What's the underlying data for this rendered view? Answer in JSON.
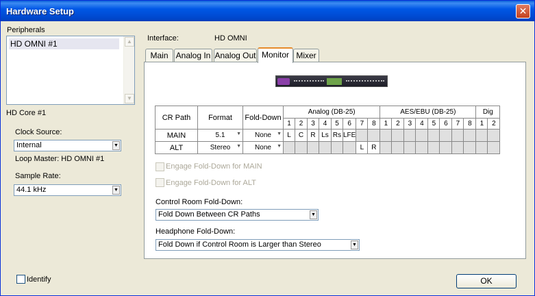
{
  "window": {
    "title": "Hardware Setup",
    "close_glyph": "✕"
  },
  "peripherals": {
    "label": "Peripherals",
    "items": [
      "HD OMNI #1"
    ]
  },
  "core": {
    "label": "HD Core #1",
    "clock_source_label": "Clock Source:",
    "clock_source_value": "Internal",
    "loop_master": "Loop Master: HD OMNI #1",
    "sample_rate_label": "Sample Rate:",
    "sample_rate_value": "44.1 kHz"
  },
  "interface": {
    "label": "Interface:",
    "value": "HD OMNI"
  },
  "tabs": [
    {
      "label": "Main"
    },
    {
      "label": "Analog In"
    },
    {
      "label": "Analog Out"
    },
    {
      "label": "Monitor",
      "active": true
    },
    {
      "label": "Mixer"
    }
  ],
  "grid": {
    "headers": {
      "cr_path": "CR Path",
      "format": "Format",
      "fold_down": "Fold-Down",
      "analog": "Analog (DB-25)",
      "aes": "AES/EBU (DB-25)",
      "dig": "Dig"
    },
    "analog_nums": [
      "1",
      "2",
      "3",
      "4",
      "5",
      "6",
      "7",
      "8"
    ],
    "aes_nums": [
      "1",
      "2",
      "3",
      "4",
      "5",
      "6",
      "7",
      "8"
    ],
    "dig_nums": [
      "1",
      "2"
    ],
    "rows": [
      {
        "path": "MAIN",
        "format": "5.1",
        "fold": "None",
        "analog": [
          "L",
          "C",
          "R",
          "Ls",
          "Rs",
          "LFE",
          "",
          ""
        ]
      },
      {
        "path": "ALT",
        "format": "Stereo",
        "fold": "None",
        "analog": [
          "",
          "",
          "",
          "",
          "",
          "",
          "L",
          "R"
        ]
      }
    ]
  },
  "engage_main": "Engage Fold-Down for MAIN",
  "engage_alt": "Engage Fold-Down for ALT",
  "control_room": {
    "label": "Control Room Fold-Down:",
    "value": "Fold Down Between CR Paths"
  },
  "headphone": {
    "label": "Headphone Fold-Down:",
    "value": "Fold Down if Control Room is Larger than Stereo"
  },
  "identify": "Identify",
  "ok": "OK"
}
